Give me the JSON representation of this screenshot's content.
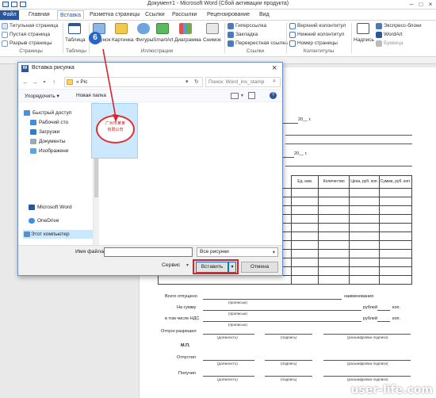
{
  "window": {
    "title": "Документ1 - Microsoft Word (Сбой активации продукта)"
  },
  "tabs": [
    "Файл",
    "Главная",
    "Вставка",
    "Разметка страницы",
    "Ссылки",
    "Рассылки",
    "Рецензирование",
    "Вид"
  ],
  "ribbon": {
    "pages": [
      "Титульная страница",
      "Пустая страница",
      "Разрыв страницы"
    ],
    "tables_label": "Таблица",
    "illustrations": [
      "Рисунок",
      "Картинка",
      "Фигуры",
      "SmartArt",
      "Диаграмма",
      "Снимок"
    ],
    "links": [
      "Гиперссылка",
      "Закладка",
      "Перекрестная ссылка"
    ],
    "header_footer": [
      "Верхний колонтитул",
      "Нижний колонтитул",
      "Номер страницы"
    ],
    "text": [
      "Надпись",
      "Экспресс-блоки",
      "WordArt",
      "Буквица"
    ],
    "groups": [
      "Страницы",
      "Таблицы",
      "Иллюстрации",
      "Ссылки",
      "Колонтитулы"
    ]
  },
  "callout_number": "6",
  "dialog": {
    "title": "Вставка рисунка",
    "path": "« Pic",
    "search_placeholder": "Поиск: Word_ins_stamp",
    "organize": "Упорядочить ▾",
    "new_folder": "Новая папка",
    "nav_items": [
      "Быстрый доступ",
      "Рабочий сто",
      "Загрузки",
      "Документы",
      "Изображени",
      "Microsoft Word",
      "OneDrive",
      "Этот компьютер"
    ],
    "filename_label": "Имя файла:",
    "filename_value": "",
    "filter": "Все рисунки",
    "tools": "Сервис",
    "insert": "Вставить",
    "cancel": "Отмена"
  },
  "stamp_text": [
    "广州市某某",
    "有限公司"
  ],
  "document": {
    "date_line1": "20__ г.",
    "date_line2": "20__ г.",
    "table_headers": [
      "Ед. изм.",
      "Количество",
      "Цена, руб. коп.",
      "Сумма, руб. коп."
    ],
    "released": "Всего отпущено",
    "naimen": "наименования",
    "propis": "(прописью)",
    "sum": "На сумму",
    "rub": "рублей",
    "kop": "коп.",
    "nds": "в том числе НДС",
    "permit": "Отпуск разрешил",
    "dolzh": "(должность)",
    "podpis": "(подпись)",
    "rasshifr": "(расшифровка подписи)",
    "mp": "М.П.",
    "otpustil": "Отпустил",
    "poluchil": "Получил"
  },
  "watermark": "user-life.com"
}
